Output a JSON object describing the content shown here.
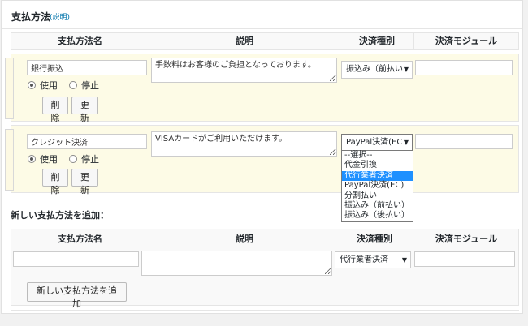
{
  "panel": {
    "title": "支払方法",
    "help": "(説明)"
  },
  "columns": [
    "支払方法名",
    "説明",
    "決済種別",
    "決済モジュール"
  ],
  "rows": [
    {
      "name": "銀行振込",
      "description": "手数料はお客様のご負担となっております。",
      "type_selected": "振込み（前払い",
      "module": "",
      "use_label": "使用",
      "stop_label": "停止",
      "delete_label": "削除",
      "update_label": "更新"
    },
    {
      "name": "クレジット決済",
      "description": "VISAカードがご利用いただけます。",
      "type_selected": "PayPal決済(EC",
      "module": "",
      "use_label": "使用",
      "stop_label": "停止",
      "delete_label": "削除",
      "update_label": "更新"
    }
  ],
  "dropdown_options": [
    "--選択--",
    "代金引換",
    "代行業者決済",
    "PayPal決済(EC)",
    "分割払い",
    "振込み（前払い）",
    "振込み（後払い）"
  ],
  "dropdown_highlight_index": 2,
  "add_section": {
    "title": "新しい支払方法を追加：",
    "name_value": "",
    "description_value": "",
    "type_selected": "代行業者決済",
    "module_value": "",
    "button_label": "新しい支払方法を追加"
  },
  "icons": {
    "dropdown_arrow": "▼"
  },
  "colors": {
    "row_bg": "#fdfbe6",
    "link": "#0073aa",
    "highlight": "#1e90ff"
  }
}
